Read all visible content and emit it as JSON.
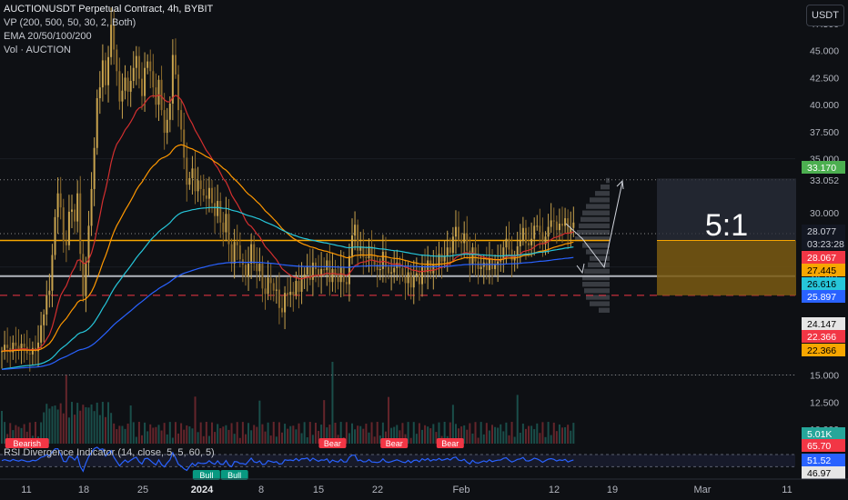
{
  "header": {
    "title": "AUCTIONUSDT Perpetual Contract, 4h, BYBIT",
    "indicators": [
      "VP (200, 500, 50, 30, 2, Both)",
      "EMA 20/50/100/200",
      "Vol · AUCTION"
    ],
    "currency_button": "USDT"
  },
  "rsi_panel": {
    "title": "RSI Divergence Indicator (14, close, 5, 5, 60, 5)",
    "labels": [
      {
        "text": "Bearish",
        "type": "bear",
        "index": 9
      },
      {
        "text": "Bear",
        "type": "bear",
        "index": 118
      },
      {
        "text": "Bear",
        "type": "bear",
        "index": 140
      },
      {
        "text": "Bear",
        "type": "bear",
        "index": 160
      },
      {
        "text": "Bull",
        "type": "bull",
        "index": 73
      },
      {
        "text": "Bull",
        "type": "bull",
        "index": 83
      }
    ]
  },
  "position_box": {
    "ratio": "5:1",
    "entry": 27.445,
    "target": 33.17,
    "stop": 22.366
  },
  "price_axis": {
    "ticks": [
      "47.500",
      "45.000",
      "42.500",
      "40.000",
      "37.500",
      "35.000",
      "33.052",
      "30.000",
      "24.147",
      "15.000",
      "12.500",
      "10.000"
    ],
    "badges": [
      {
        "text": "33.170",
        "bg": "#4caf50",
        "fg": "#ffffff"
      },
      {
        "text": "28.077",
        "bg": "#131722",
        "fg": "#d1d4dc"
      },
      {
        "text": "03:23:28",
        "bg": "#131722",
        "fg": "#d1d4dc"
      },
      {
        "text": "28.067",
        "bg": "#f23645",
        "fg": "#ffffff"
      },
      {
        "text": "27.445",
        "bg": "#f7a600",
        "fg": "#000000"
      },
      {
        "text": "26.616",
        "bg": "#26c6da",
        "fg": "#000000"
      },
      {
        "text": "25.897",
        "bg": "#2962ff",
        "fg": "#ffffff"
      },
      {
        "text": "24.147",
        "bg": "#e6e6e6",
        "fg": "#000000"
      },
      {
        "text": "22.366",
        "bg": "#f23645",
        "fg": "#ffffff"
      },
      {
        "text": "22.366",
        "bg": "#f7a600",
        "fg": "#000000"
      }
    ],
    "volume_badge": {
      "text": "5.01K",
      "bg": "#26a69a",
      "fg": "#ffffff"
    },
    "rsi_badges": [
      {
        "text": "65.70",
        "bg": "#f23645",
        "fg": "#ffffff"
      },
      {
        "text": "51.52",
        "bg": "#2962ff",
        "fg": "#ffffff"
      },
      {
        "text": "46.97",
        "bg": "#e6e6e6",
        "fg": "#000000"
      }
    ]
  },
  "time_axis": {
    "labels": [
      "11",
      "18",
      "25",
      "2024",
      "8",
      "15",
      "22",
      "Feb",
      "12",
      "19",
      "Mar",
      "11"
    ]
  },
  "chart_data": {
    "type": "candlestick",
    "symbol": "AUCTIONUSDT",
    "timeframe": "4h",
    "ylim": [
      10,
      48
    ],
    "close": [
      17.2,
      17.8,
      17.5,
      17.1,
      18.0,
      17.7,
      17.3,
      17.9,
      17.6,
      17.0,
      16.9,
      17.5,
      17.2,
      18.0,
      19.6,
      20.6,
      22.4,
      22.8,
      26.1,
      29.6,
      31.8,
      30.5,
      27.4,
      27.0,
      30.1,
      30.3,
      29.2,
      31.8,
      26.2,
      22.3,
      25.4,
      28.8,
      32.2,
      36.0,
      40.6,
      41.6,
      44.1,
      41.8,
      44.4,
      47.4,
      45.1,
      43.1,
      40.3,
      41.3,
      42.5,
      41.2,
      42.2,
      43.4,
      44.5,
      42.4,
      40.8,
      43.4,
      44.0,
      43.1,
      41.6,
      40.0,
      42.3,
      39.5,
      37.4,
      38.6,
      40.1,
      44.6,
      42.8,
      39.5,
      37.7,
      35.1,
      32.6,
      33.2,
      34.1,
      32.0,
      33.0,
      32.2,
      31.6,
      31.3,
      32.3,
      30.9,
      29.7,
      31.1,
      29.1,
      28.2,
      29.9,
      27.1,
      25.3,
      27.3,
      27.0,
      25.7,
      25.2,
      24.1,
      25.3,
      27.1,
      25.3,
      24.6,
      25.3,
      23.0,
      22.5,
      24.0,
      23.5,
      22.8,
      22.9,
      21.2,
      20.8,
      22.6,
      22.4,
      22.7,
      22.4,
      23.7,
      22.7,
      24.0,
      24.3,
      25.1,
      23.8,
      25.4,
      24.8,
      24.1,
      24.8,
      24.7,
      25.6,
      23.6,
      24.8,
      24.2,
      23.6,
      25.0,
      23.6,
      23.4,
      26.0,
      27.9,
      28.9,
      26.5,
      26.9,
      25.9,
      25.8,
      26.9,
      25.6,
      25.2,
      24.7,
      24.8,
      26.4,
      25.0,
      24.4,
      24.5,
      24.9,
      25.4,
      24.9,
      24.1,
      23.5,
      24.5,
      23.1,
      24.1,
      24.4,
      23.4,
      25.1,
      24.5,
      25.6,
      24.4,
      25.3,
      25.1,
      26.2,
      25.5,
      26.0,
      26.8,
      26.3,
      27.8,
      28.7,
      27.5,
      27.2,
      28.1,
      26.5,
      25.2,
      26.8,
      25.5,
      24.8,
      25.0,
      25.4,
      24.7,
      25.8,
      24.8,
      25.2,
      25.5,
      25.7,
      26.8,
      27.6,
      26.6,
      25.6,
      26.0,
      26.9,
      27.4,
      28.6,
      27.2,
      27.0,
      27.6,
      28.8,
      28.8,
      28.2,
      27.1,
      27.8,
      28.7,
      29.3,
      29.2,
      28.4,
      29.0,
      28.8,
      29.5,
      28.1,
      28.6,
      29.1
    ],
    "emas": [
      {
        "name": "EMA 20",
        "period": 20,
        "color": "#d32f2f"
      },
      {
        "name": "EMA 50",
        "period": 50,
        "color": "#ff9800"
      },
      {
        "name": "EMA 100",
        "period": 100,
        "color": "#26c6da"
      },
      {
        "name": "EMA 200",
        "period": 200,
        "color": "#2962ff"
      }
    ],
    "levels": [
      {
        "value": 27.445,
        "color": "#f7a600",
        "style": "solid"
      },
      {
        "value": 24.147,
        "color": "#b2b5be",
        "style": "solid"
      },
      {
        "value": 22.366,
        "color": "#f23645",
        "style": "dashed"
      },
      {
        "value": 33.052,
        "color": "#888888",
        "style": "dotted"
      },
      {
        "value": 28.077,
        "color": "#888888",
        "style": "dotted"
      },
      {
        "value": 15.0,
        "color": "#888888",
        "style": "dotted"
      }
    ],
    "volume_last": "5.01K",
    "rsi_last": 51.52,
    "rsi_bands": [
      60,
      40
    ]
  }
}
